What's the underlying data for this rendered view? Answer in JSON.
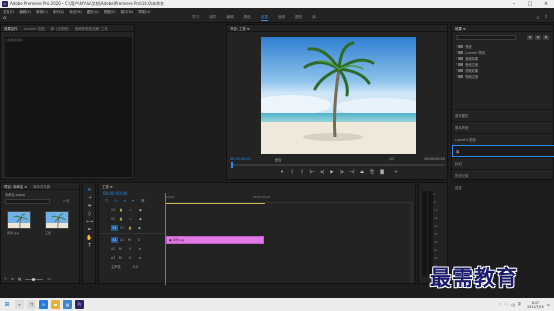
{
  "window": {
    "title": "Adobe Premiere Pro 2020 - C:\\用户\\hfr\\lu\\文档\\Adobe\\Premiere Pro\\14.0\\未命名",
    "app_icon": "Pr"
  },
  "menu": [
    "文件(F)",
    "编辑(E)",
    "剪辑(C)",
    "序列(S)",
    "标记(M)",
    "图形(G)",
    "视图(V)",
    "窗口(W)",
    "帮助(H)"
  ],
  "workspaces": {
    "tabs": [
      "学习",
      "组件",
      "编辑",
      "颜色",
      "效果",
      "音频",
      "图形",
      "库"
    ],
    "active": "效果"
  },
  "source_panel": {
    "tabs": [
      "效果控件",
      "Lumetri 范围",
      "源: (无剪辑)",
      "音频剪辑混合器: 工览"
    ],
    "no_clip_text": "(未选择剪辑)"
  },
  "program_panel": {
    "tab": "节目: 工览 ≡",
    "current_timecode": "00:00:00:00",
    "fit_label": "适合",
    "ratio_label": "1/2",
    "duration": "00:00:05:00"
  },
  "effects_panel": {
    "tab": "效果 ≡",
    "tree": [
      "预设",
      "Lumetri 预设",
      "音频效果",
      "音频过渡",
      "视频效果",
      "视频过渡"
    ],
    "sections": [
      "基本图形",
      "基本声音",
      "Lumetri 颜色",
      "库",
      "标记",
      "历史记录",
      "信息"
    ],
    "selected_section": "库"
  },
  "project_panel": {
    "tabs": [
      "项目: 未命名 ≡",
      "媒体浏览器"
    ],
    "project_file": "未命名.prproj",
    "item_count": "2 项",
    "items": [
      {
        "name": "风景.jpg"
      },
      {
        "name": "工览"
      }
    ]
  },
  "timeline": {
    "tab": "工览 ≡",
    "timecode": "00:00:00:00",
    "ruler_ticks": [
      "00:00",
      "00:00:05:00"
    ],
    "video_tracks": [
      "V3",
      "V2",
      "V1"
    ],
    "audio_tracks": [
      "A1",
      "A2",
      "A3"
    ],
    "master_label": "主声道",
    "master_value": "0.0",
    "clip_label": "风景.jpg"
  },
  "meters": {
    "scale": [
      "0",
      "-6",
      "-12",
      "-18",
      "-24",
      "-30",
      "-36",
      "-42",
      "-48",
      "-54"
    ]
  },
  "watermark": "最需教育",
  "taskbar": {
    "time": "8:47",
    "date": "2021/7/29"
  }
}
